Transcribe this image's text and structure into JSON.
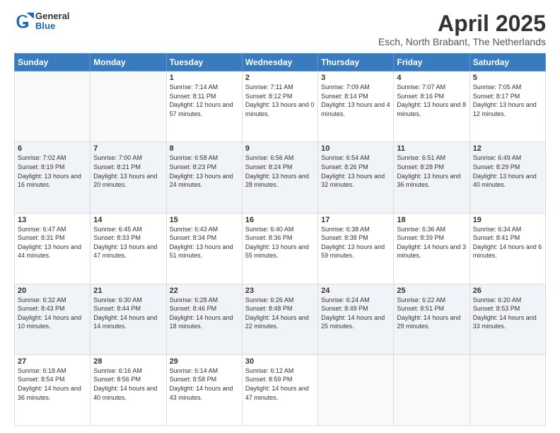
{
  "header": {
    "logo_general": "General",
    "logo_blue": "Blue",
    "title": "April 2025",
    "subtitle": "Esch, North Brabant, The Netherlands"
  },
  "weekdays": [
    "Sunday",
    "Monday",
    "Tuesday",
    "Wednesday",
    "Thursday",
    "Friday",
    "Saturday"
  ],
  "weeks": [
    [
      {
        "day": "",
        "empty": true
      },
      {
        "day": "",
        "empty": true
      },
      {
        "day": "1",
        "sunrise": "Sunrise: 7:14 AM",
        "sunset": "Sunset: 8:11 PM",
        "daylight": "Daylight: 12 hours and 57 minutes."
      },
      {
        "day": "2",
        "sunrise": "Sunrise: 7:11 AM",
        "sunset": "Sunset: 8:12 PM",
        "daylight": "Daylight: 13 hours and 0 minutes."
      },
      {
        "day": "3",
        "sunrise": "Sunrise: 7:09 AM",
        "sunset": "Sunset: 8:14 PM",
        "daylight": "Daylight: 13 hours and 4 minutes."
      },
      {
        "day": "4",
        "sunrise": "Sunrise: 7:07 AM",
        "sunset": "Sunset: 8:16 PM",
        "daylight": "Daylight: 13 hours and 8 minutes."
      },
      {
        "day": "5",
        "sunrise": "Sunrise: 7:05 AM",
        "sunset": "Sunset: 8:17 PM",
        "daylight": "Daylight: 13 hours and 12 minutes."
      }
    ],
    [
      {
        "day": "6",
        "sunrise": "Sunrise: 7:02 AM",
        "sunset": "Sunset: 8:19 PM",
        "daylight": "Daylight: 13 hours and 16 minutes."
      },
      {
        "day": "7",
        "sunrise": "Sunrise: 7:00 AM",
        "sunset": "Sunset: 8:21 PM",
        "daylight": "Daylight: 13 hours and 20 minutes."
      },
      {
        "day": "8",
        "sunrise": "Sunrise: 6:58 AM",
        "sunset": "Sunset: 8:23 PM",
        "daylight": "Daylight: 13 hours and 24 minutes."
      },
      {
        "day": "9",
        "sunrise": "Sunrise: 6:56 AM",
        "sunset": "Sunset: 8:24 PM",
        "daylight": "Daylight: 13 hours and 28 minutes."
      },
      {
        "day": "10",
        "sunrise": "Sunrise: 6:54 AM",
        "sunset": "Sunset: 8:26 PM",
        "daylight": "Daylight: 13 hours and 32 minutes."
      },
      {
        "day": "11",
        "sunrise": "Sunrise: 6:51 AM",
        "sunset": "Sunset: 8:28 PM",
        "daylight": "Daylight: 13 hours and 36 minutes."
      },
      {
        "day": "12",
        "sunrise": "Sunrise: 6:49 AM",
        "sunset": "Sunset: 8:29 PM",
        "daylight": "Daylight: 13 hours and 40 minutes."
      }
    ],
    [
      {
        "day": "13",
        "sunrise": "Sunrise: 6:47 AM",
        "sunset": "Sunset: 8:31 PM",
        "daylight": "Daylight: 13 hours and 44 minutes."
      },
      {
        "day": "14",
        "sunrise": "Sunrise: 6:45 AM",
        "sunset": "Sunset: 8:33 PM",
        "daylight": "Daylight: 13 hours and 47 minutes."
      },
      {
        "day": "15",
        "sunrise": "Sunrise: 6:43 AM",
        "sunset": "Sunset: 8:34 PM",
        "daylight": "Daylight: 13 hours and 51 minutes."
      },
      {
        "day": "16",
        "sunrise": "Sunrise: 6:40 AM",
        "sunset": "Sunset: 8:36 PM",
        "daylight": "Daylight: 13 hours and 55 minutes."
      },
      {
        "day": "17",
        "sunrise": "Sunrise: 6:38 AM",
        "sunset": "Sunset: 8:38 PM",
        "daylight": "Daylight: 13 hours and 59 minutes."
      },
      {
        "day": "18",
        "sunrise": "Sunrise: 6:36 AM",
        "sunset": "Sunset: 8:39 PM",
        "daylight": "Daylight: 14 hours and 3 minutes."
      },
      {
        "day": "19",
        "sunrise": "Sunrise: 6:34 AM",
        "sunset": "Sunset: 8:41 PM",
        "daylight": "Daylight: 14 hours and 6 minutes."
      }
    ],
    [
      {
        "day": "20",
        "sunrise": "Sunrise: 6:32 AM",
        "sunset": "Sunset: 8:43 PM",
        "daylight": "Daylight: 14 hours and 10 minutes."
      },
      {
        "day": "21",
        "sunrise": "Sunrise: 6:30 AM",
        "sunset": "Sunset: 8:44 PM",
        "daylight": "Daylight: 14 hours and 14 minutes."
      },
      {
        "day": "22",
        "sunrise": "Sunrise: 6:28 AM",
        "sunset": "Sunset: 8:46 PM",
        "daylight": "Daylight: 14 hours and 18 minutes."
      },
      {
        "day": "23",
        "sunrise": "Sunrise: 6:26 AM",
        "sunset": "Sunset: 8:48 PM",
        "daylight": "Daylight: 14 hours and 22 minutes."
      },
      {
        "day": "24",
        "sunrise": "Sunrise: 6:24 AM",
        "sunset": "Sunset: 8:49 PM",
        "daylight": "Daylight: 14 hours and 25 minutes."
      },
      {
        "day": "25",
        "sunrise": "Sunrise: 6:22 AM",
        "sunset": "Sunset: 8:51 PM",
        "daylight": "Daylight: 14 hours and 29 minutes."
      },
      {
        "day": "26",
        "sunrise": "Sunrise: 6:20 AM",
        "sunset": "Sunset: 8:53 PM",
        "daylight": "Daylight: 14 hours and 33 minutes."
      }
    ],
    [
      {
        "day": "27",
        "sunrise": "Sunrise: 6:18 AM",
        "sunset": "Sunset: 8:54 PM",
        "daylight": "Daylight: 14 hours and 36 minutes."
      },
      {
        "day": "28",
        "sunrise": "Sunrise: 6:16 AM",
        "sunset": "Sunset: 8:56 PM",
        "daylight": "Daylight: 14 hours and 40 minutes."
      },
      {
        "day": "29",
        "sunrise": "Sunrise: 6:14 AM",
        "sunset": "Sunset: 8:58 PM",
        "daylight": "Daylight: 14 hours and 43 minutes."
      },
      {
        "day": "30",
        "sunrise": "Sunrise: 6:12 AM",
        "sunset": "Sunset: 8:59 PM",
        "daylight": "Daylight: 14 hours and 47 minutes."
      },
      {
        "day": "",
        "empty": true
      },
      {
        "day": "",
        "empty": true
      },
      {
        "day": "",
        "empty": true
      }
    ]
  ]
}
